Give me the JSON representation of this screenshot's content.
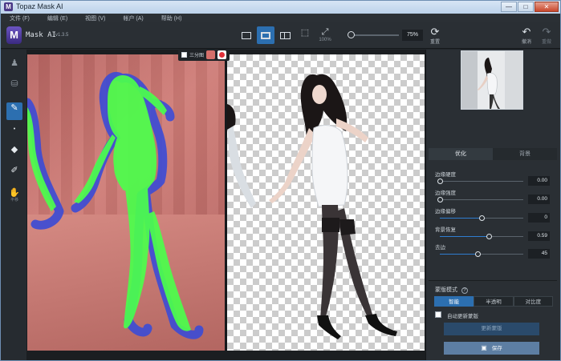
{
  "window": {
    "title": "Topaz Mask AI",
    "min": "—",
    "max": "□",
    "close": "✕"
  },
  "menu": [
    "文件 (F)",
    "编辑 (E)",
    "视图 (V)",
    "帐户 (A)",
    "帮助 (H)"
  ],
  "app": {
    "logo_letter": "M",
    "name": "Mask AI",
    "version": "v1.3.5"
  },
  "toolbar": {
    "zoom_label": "100%",
    "zoom_value": "75%",
    "zoom_fraction": 0.0,
    "reset_label": "重置",
    "undo_label": "撤消",
    "redo_label": "重做"
  },
  "tools": [
    {
      "label": "",
      "icon": "person-icon"
    },
    {
      "label": "",
      "icon": "bucket-icon"
    },
    {
      "label": "",
      "icon": "brush-gear-icon"
    },
    {
      "label": "",
      "icon": "dot-icon"
    },
    {
      "label": "",
      "icon": "fill-bucket-icon"
    },
    {
      "label": "",
      "icon": "eyedropper-icon"
    },
    {
      "label": "平移",
      "icon": "hand-icon"
    }
  ],
  "splitbar": {
    "label": "三分图"
  },
  "panel": {
    "tabs": [
      "优化",
      "背景"
    ],
    "params": [
      {
        "label": "边缘硬度",
        "value": "0.00",
        "fraction": 0.0
      },
      {
        "label": "边缘强度",
        "value": "0.00",
        "fraction": 0.0
      },
      {
        "label": "边缘偏移",
        "value": "0",
        "fraction": 0.5
      },
      {
        "label": "背景恢复",
        "value": "0.59",
        "fraction": 0.59
      },
      {
        "label": "去边",
        "value": "45",
        "fraction": 0.45
      }
    ],
    "mask_mode_label": "蒙版模式",
    "help": "?",
    "modes": [
      "智能",
      "半透明",
      "对比度"
    ],
    "auto_update_label": "自动更新蒙版",
    "update_button": "更新蒙版",
    "save_button": "保存"
  },
  "colors": {
    "accent": "#2c6fb0",
    "foreground_mask": "#4cff4c",
    "background_mask": "#d46f6a",
    "edge": "#3b4bd6"
  }
}
